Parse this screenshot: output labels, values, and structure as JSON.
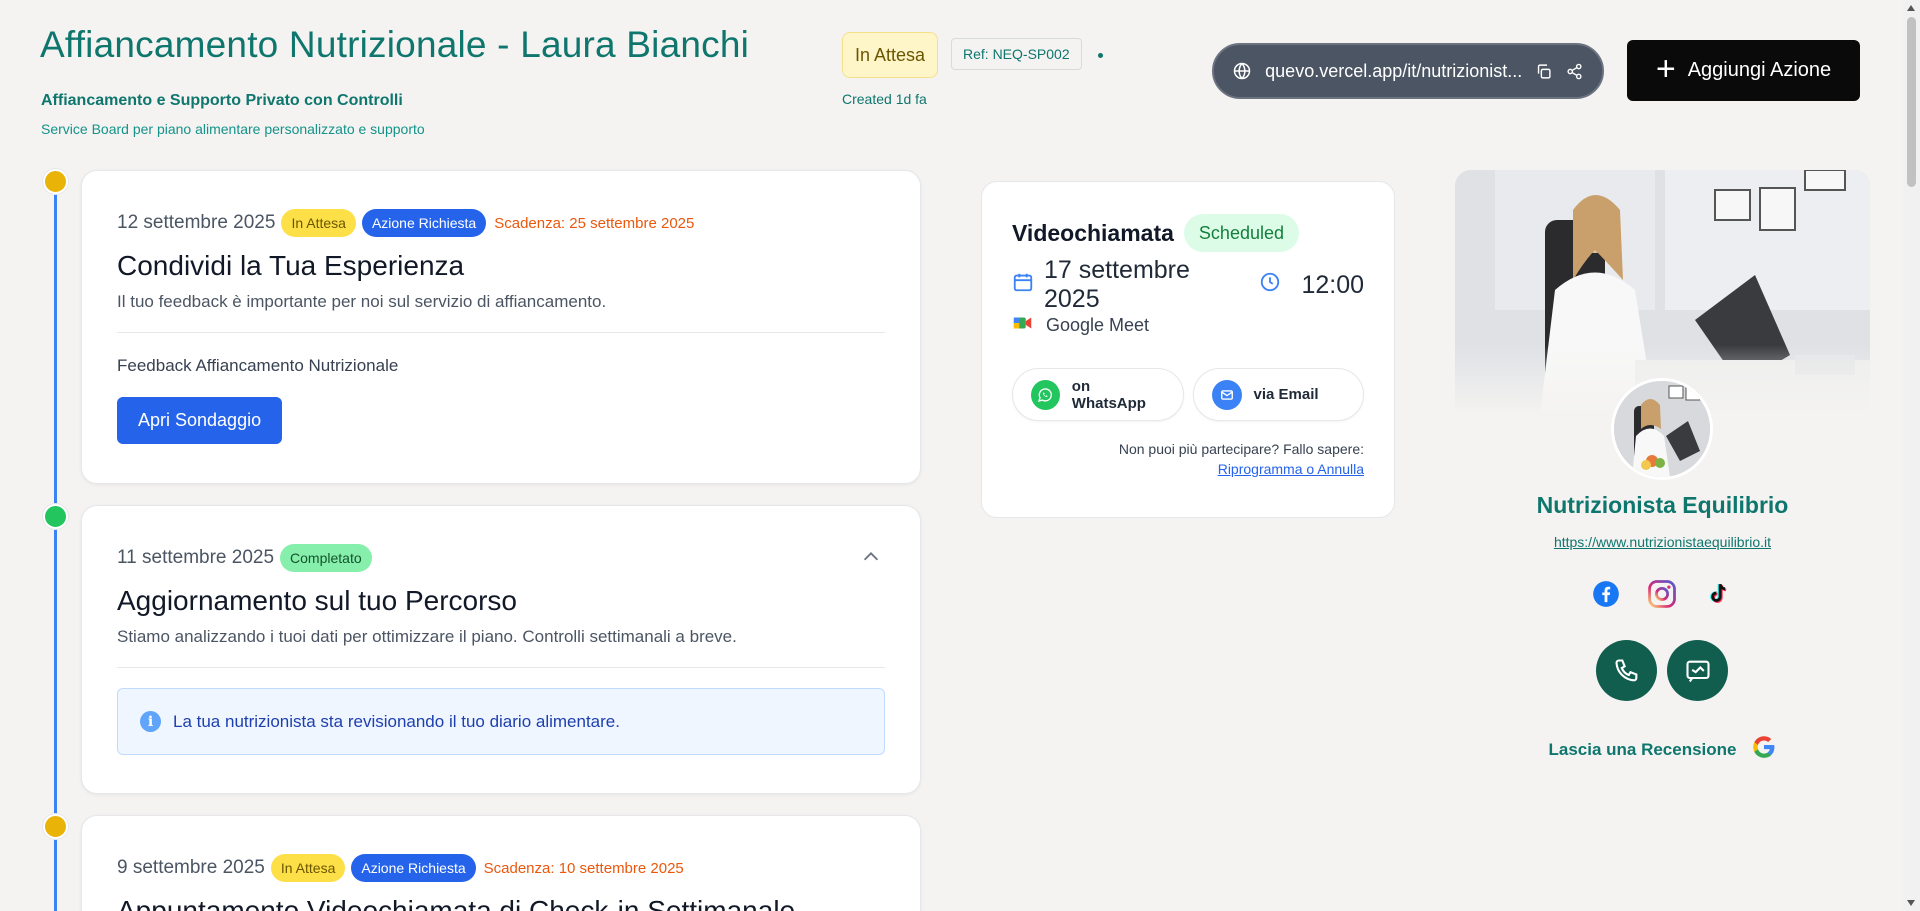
{
  "header": {
    "title": "Affiancamento Nutrizionale - Laura Bianchi",
    "subtitle": "Affiancamento e Supporto Privato con Controlli",
    "description": "Service Board per piano alimentare personalizzato e supporto",
    "status": "In Attesa",
    "reference": "Ref: NEQ-SP002",
    "created": "Created 1d fa",
    "url": "quevo.vercel.app/it/nutrizionist...",
    "add_action_label": "Aggiungi Azione"
  },
  "timeline": [
    {
      "date": "12 settembre 2025",
      "status_badge": "In Attesa",
      "action_badge": "Azione Richiesta",
      "deadline": "Scadenza: 25 settembre 2025",
      "title": "Condividi la Tua Esperienza",
      "description": "Il tuo feedback è importante per noi sul servizio di affiancamento.",
      "survey_label": "Feedback Affiancamento Nutrizionale",
      "button_label": "Apri Sondaggio"
    },
    {
      "date": "11 settembre 2025",
      "status_badge": "Completato",
      "title": "Aggiornamento sul tuo Percorso",
      "description": "Stiamo analizzando i tuoi dati per ottimizzare il piano. Controlli settimanali a breve.",
      "info": "La tua nutrizionista sta revisionando il tuo diario alimentare."
    },
    {
      "date": "9 settembre 2025",
      "status_badge": "In Attesa",
      "action_badge": "Azione Richiesta",
      "deadline": "Scadenza: 10 settembre 2025",
      "title": "Appuntamento Videochiamata di Check-in Settimanale"
    }
  ],
  "video_call": {
    "title": "Videochiamata",
    "status": "Scheduled",
    "date": "17 settembre 2025",
    "time": "12:00",
    "platform": "Google Meet",
    "whatsapp_label": "on WhatsApp",
    "email_label": "via Email",
    "note": "Non puoi più partecipare? Fallo sapere:",
    "reschedule_link": "Riprogramma o Annulla"
  },
  "profile": {
    "name": "Nutrizionista Equilibrio",
    "website": "https://www.nutrizionistaequilibrio.it",
    "socials": [
      "facebook-icon",
      "instagram-icon",
      "tiktok-icon"
    ],
    "review_label": "Lascia una Recensione"
  },
  "colors": {
    "brand": "#0f766e",
    "primary": "#2563eb",
    "pending": "#fde047",
    "done": "#86efac",
    "deadline": "#ea580c"
  }
}
